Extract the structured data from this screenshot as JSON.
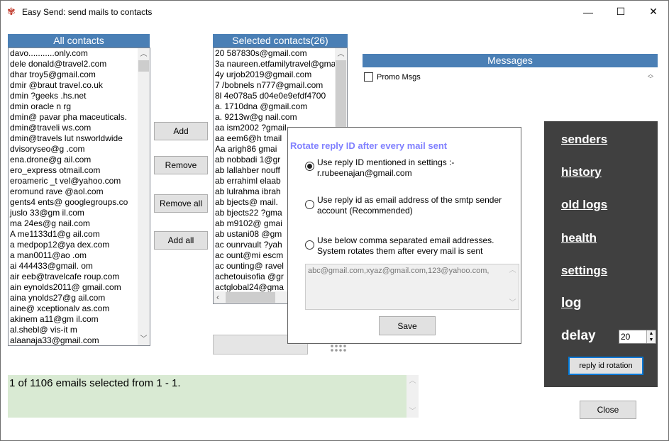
{
  "window": {
    "title": "Easy Send: send mails to contacts",
    "minimize": "—",
    "maximize": "☐",
    "close": "✕"
  },
  "all_contacts": {
    "header": "All contacts",
    "items": [
      "davo...........only.com",
      "dele donald@travel2.com",
      "dhar troy5@gmail.com",
      "dmir @braut travel.co.uk",
      "dmin ?geeks .hs.net",
      "dmin oracle n rg",
      "dmin@ pavar pha maceuticals.",
      "dmin@traveli ws.com",
      "dmin@travels lut nsworldwide",
      "dvisoryseo@g .com",
      "ena.drone@g ail.com",
      "ero_express otmail.com",
      "eroameric _t vel@yahoo.com",
      "eromund rave @aol.com",
      "gents4 ents@ googlegroups.co",
      "juslo 33@gm il.com",
      "ma 24es@g nail.com",
      "A me1133d1@g ail.com",
      "a medpop12@ya dex.com",
      "a man0011@ao .om",
      "ai 444433@gmail. om",
      "air eeb@travelcafe roup.com",
      "ain eynolds2011@ gmail.com",
      "aina ynolds27@g ail.com",
      "aine@ xceptionalv as.com",
      "akinem a11@gm il.com",
      "al.shebl@ vis-it m",
      "alaanaja33@gmail.com"
    ]
  },
  "selected_contacts": {
    "header": "Selected contacts(26)",
    "items": [
      "20 587830s@gmail.com",
      "3a naureen.etfamilytravel@gma",
      "4y urjob2019@gmail.com",
      "7 /bobnels n777@gmail.com",
      "8l 4e078a5 d04e0e9efdf4700",
      "a. 1710dna @gmail.com",
      "a. 9213w@g nail.com",
      "aa ism2002 ?gmail",
      "aa eem6@h tmail",
      "Aa arigh86 gmai",
      "ab nobbadi 1@gr",
      "ab lallahber nouff",
      "ab errahiml elaab",
      "ab lulrahma ibrah",
      "ab bjects@ mail.",
      "ab bjects22 ?gma",
      "ab m9102@ gmai",
      "ab ustani08 @gm",
      "ac ounrvault ?yah",
      "ac ount@mi escm",
      "ac ounting@ ravel",
      "achetouisofia @gr",
      "actglobal24@gma"
    ]
  },
  "buttons": {
    "add": "Add",
    "remove": "Remove",
    "remove_all": "Remove all",
    "add_all": "Add all",
    "close": "Close",
    "reply_rotation": "reply id rotation"
  },
  "messages": {
    "header": "Messages",
    "items": [
      {
        "label": "Promo Msgs",
        "checked": false
      }
    ]
  },
  "dialog": {
    "title": "Rotate reply ID after every mail sent",
    "options": [
      {
        "line1": "Use reply ID mentioned in settings :-",
        "line2": "r.rubeenajan@gmail.com",
        "selected": true
      },
      {
        "line1": "Use reply id as email address of the smtp sender",
        "line2": "account (Recommended)",
        "selected": false
      },
      {
        "line1": "Use below comma separated email addresses.",
        "line2": "System rotates them after every mail is sent",
        "selected": false
      }
    ],
    "emails_value": "abc@gmail.com,xyaz@gmail.com,123@yahoo.com,",
    "save": "Save",
    "title_color": "#8080ff"
  },
  "sidebar": {
    "links": [
      "senders",
      "history",
      "old logs",
      "health",
      "settings",
      "log"
    ],
    "delay_label": "delay",
    "delay_value": "20"
  },
  "status": {
    "text": "1 of 1106 emails selected from 1 - 1.",
    "bg": "#d9ead3"
  }
}
